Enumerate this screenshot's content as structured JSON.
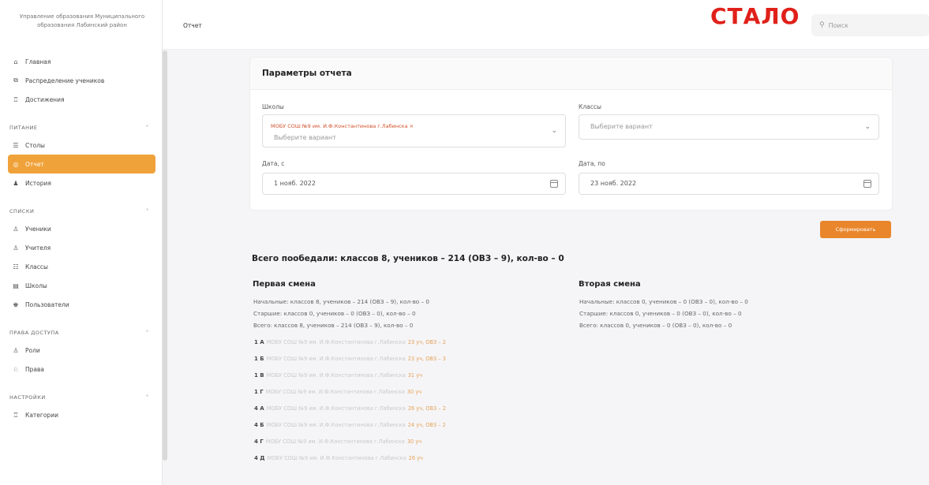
{
  "sidebar": {
    "org_name": "Управление образования Муниципального образования Лабинский район",
    "main_items": [
      {
        "label": "Главная",
        "icon": "home-icon"
      },
      {
        "label": "Распределение учеников",
        "icon": "distribution-icon"
      },
      {
        "label": "Достижения",
        "icon": "trophy-icon"
      }
    ],
    "section_food": {
      "title": "ПИТАНИЕ",
      "items": [
        {
          "label": "Столы",
          "icon": "tables-icon"
        },
        {
          "label": "Отчет",
          "icon": "report-icon"
        },
        {
          "label": "История",
          "icon": "history-icon"
        }
      ]
    },
    "section_lists": {
      "title": "СПИСКИ",
      "items": [
        {
          "label": "Ученики",
          "icon": "students-icon"
        },
        {
          "label": "Учителя",
          "icon": "teachers-icon"
        },
        {
          "label": "Классы",
          "icon": "classes-icon"
        },
        {
          "label": "Школы",
          "icon": "schools-icon"
        },
        {
          "label": "Пользователи",
          "icon": "users-icon"
        }
      ]
    },
    "section_access": {
      "title": "ПРАВА ДОСТУПА",
      "items": [
        {
          "label": "Роли",
          "icon": "roles-icon"
        },
        {
          "label": "Права",
          "icon": "rights-icon"
        }
      ]
    },
    "section_settings": {
      "title": "НАСТРОЙКИ",
      "items": [
        {
          "label": "Категории",
          "icon": "categories-icon"
        }
      ]
    }
  },
  "header": {
    "breadcrumb": "Отчет",
    "overlay_label": "СТАЛО",
    "search_placeholder": "Поиск"
  },
  "params": {
    "title": "Параметры отчета",
    "schools_label": "Школы",
    "schools_tag": "МОБУ СОШ №9 им. И.Ф.Константинова г.Лабинска ×",
    "schools_placeholder": "Выберите вариант",
    "classes_label": "Классы",
    "classes_placeholder": "Выберите вариант",
    "date_from_label": "Дата, с",
    "date_from_value": "1 нояб. 2022",
    "date_to_label": "Дата, по",
    "date_to_value": "23 нояб. 2022",
    "submit_label": "Сформировать"
  },
  "report": {
    "total": "Всего пообедали: классов 8, учеников – 214 (ОВЗ – 9), кол-во – 0",
    "first_shift": {
      "title": "Первая смена",
      "lines": [
        "Начальные: классов 8, учеников – 214 (ОВЗ – 9), кол-во – 0",
        "Старшие: классов 0, учеников – 0 (ОВЗ – 0), кол-во – 0",
        "Всего: классов 8, учеников – 214 (ОВЗ – 9), кол-во – 0"
      ]
    },
    "second_shift": {
      "title": "Вторая смена",
      "lines": [
        "Начальные: классов 0, учеников – 0 (ОВЗ – 0), кол-во – 0",
        "Старшие: классов 0, учеников – 0 (ОВЗ – 0), кол-во – 0",
        "Всего: классов 0, учеников – 0 (ОВЗ – 0), кол-во – 0"
      ]
    },
    "classes": [
      {
        "code": "1 А",
        "school": "МОБУ СОШ №9 им. И.Ф.Константинова г.Лабинска",
        "count": "23 уч, ОВЗ – 2"
      },
      {
        "code": "1 Б",
        "school": "МОБУ СОШ №9 им. И.Ф.Константинова г.Лабинска",
        "count": "23 уч, ОВЗ – 3"
      },
      {
        "code": "1 В",
        "school": "МОБУ СОШ №9 им. И.Ф.Константинова г.Лабинска",
        "count": "31 уч"
      },
      {
        "code": "1 Г",
        "school": "МОБУ СОШ №9 им. И.Ф.Константинова г.Лабинска",
        "count": "30 уч"
      },
      {
        "code": "4 А",
        "school": "МОБУ СОШ №9 им. И.Ф.Константинова г.Лабинска",
        "count": "26 уч, ОВЗ – 2"
      },
      {
        "code": "4 Б",
        "school": "МОБУ СОШ №9 им. И.Ф.Константинова г.Лабинска",
        "count": "24 уч, ОВЗ – 2"
      },
      {
        "code": "4 Г",
        "school": "МОБУ СОШ №9 им. И.Ф.Константинова г.Лабинска",
        "count": "30 уч"
      },
      {
        "code": "4 Д",
        "school": "МОБУ СОШ №9 им. И.Ф.Константинова г.Лабинска",
        "count": "26 уч"
      }
    ]
  }
}
